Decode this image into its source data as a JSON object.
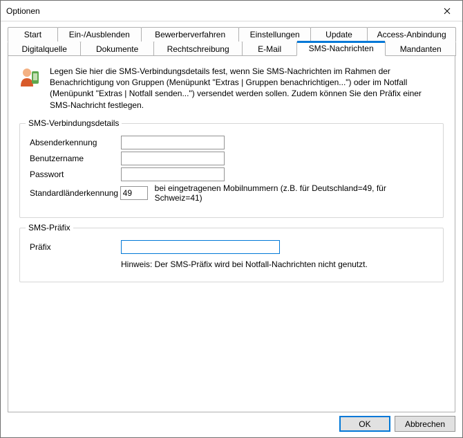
{
  "window": {
    "title": "Optionen"
  },
  "tabs_row1": [
    "Start",
    "Ein-/Ausblenden",
    "Bewerberverfahren",
    "Einstellungen",
    "Update",
    "Access-Anbindung"
  ],
  "tabs_row2": [
    "Digitalquelle",
    "Dokumente",
    "Rechtschreibung",
    "E-Mail",
    "SMS-Nachrichten",
    "Mandanten"
  ],
  "active_tab": "SMS-Nachrichten",
  "intro": "Legen Sie hier die SMS-Verbindungsdetails fest, wenn Sie SMS-Nachrichten im Rahmen der Benachrichtigung von Gruppen (Menüpunkt \"Extras | Gruppen benachrichtigen...\") oder im Notfall (Menüpunkt \"Extras | Notfall senden...\") versendet werden sollen. Zudem können Sie den Präfix einer SMS-Nachricht festlegen.",
  "group_conn": {
    "title": "SMS-Verbindungsdetails",
    "sender_label": "Absenderkennung",
    "sender_value": "",
    "user_label": "Benutzername",
    "user_value": "",
    "pass_label": "Passwort",
    "pass_value": "",
    "cc_label": "Standardländerkennung",
    "cc_value": "49",
    "cc_after": "bei eingetragenen Mobilnummern (z.B. für Deutschland=49, für Schweiz=41)"
  },
  "group_prefix": {
    "title": "SMS-Präfix",
    "prefix_label": "Präfix",
    "prefix_value": "",
    "hint": "Hinweis: Der SMS-Präfix wird bei Notfall-Nachrichten nicht genutzt."
  },
  "buttons": {
    "ok": "OK",
    "cancel": "Abbrechen"
  }
}
